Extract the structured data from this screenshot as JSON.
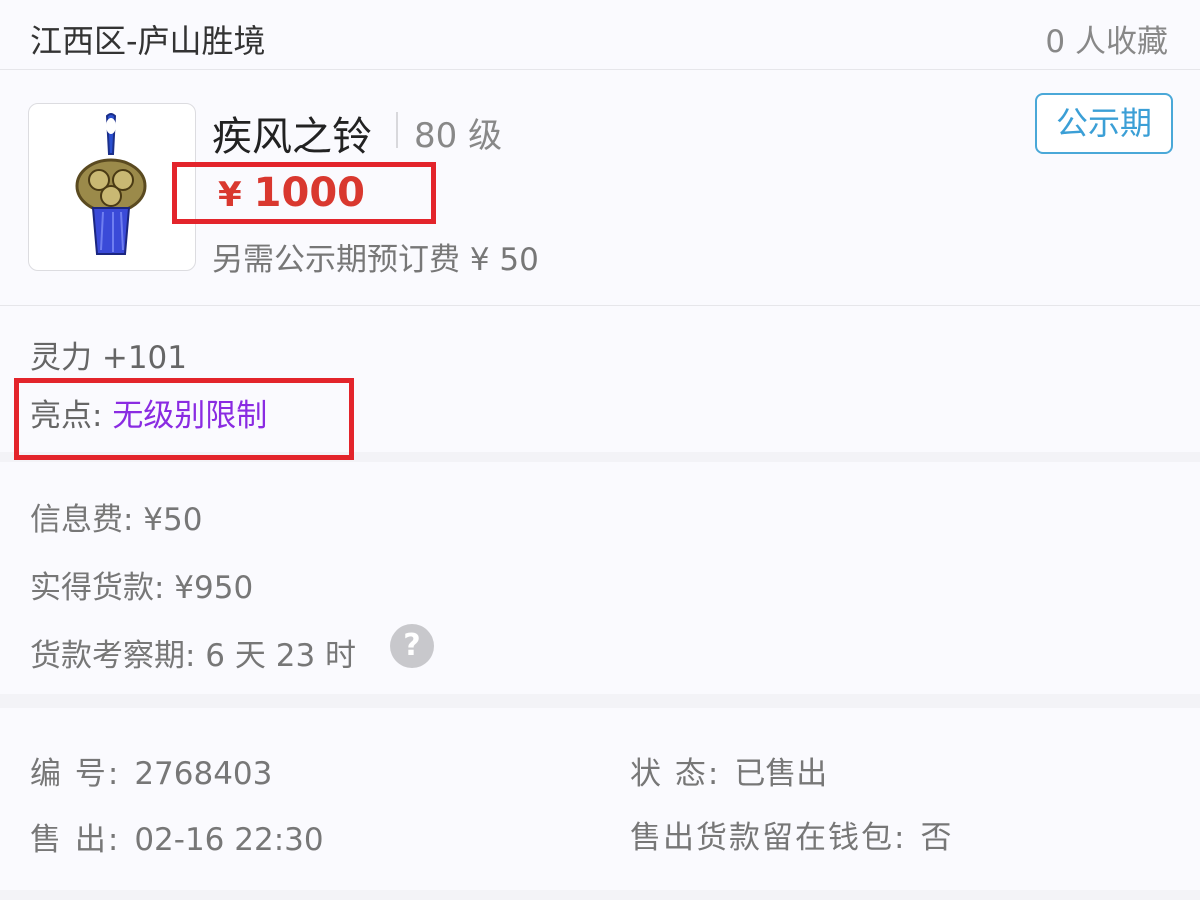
{
  "header": {
    "region": "江西区-庐山胜境",
    "favorites": "0 人收藏"
  },
  "item": {
    "name": "疾风之铃",
    "level": "80 级",
    "currency": "¥",
    "price": "1000",
    "extra_fee": "另需公示期预订费 ¥ 50",
    "status_button": "公示期",
    "attribute": "灵力 +101",
    "highlight_label": "亮点: ",
    "highlight_value": "无级别限制"
  },
  "fees": {
    "info_fee": "信息费: ¥50",
    "net_payment": "实得货款: ¥950",
    "review_period": "货款考察期: 6 天 23 时",
    "help_icon_glyph": "?"
  },
  "details": {
    "id_label": "编 号:",
    "id_value": "2768403",
    "status_label": "状 态:",
    "status_value": "已售出",
    "sold_label": "售 出:",
    "sold_value": "02-16 22:30",
    "wallet_label": "售出货款留在钱包:",
    "wallet_value": "否"
  },
  "colors": {
    "price": "#d9382f",
    "highlight": "#8a2be2",
    "status_button": "#3b9fd6",
    "annotation_box": "#e3242b"
  },
  "icons": {
    "item_image": "bell-pendant-icon",
    "help": "question-circle-icon"
  }
}
